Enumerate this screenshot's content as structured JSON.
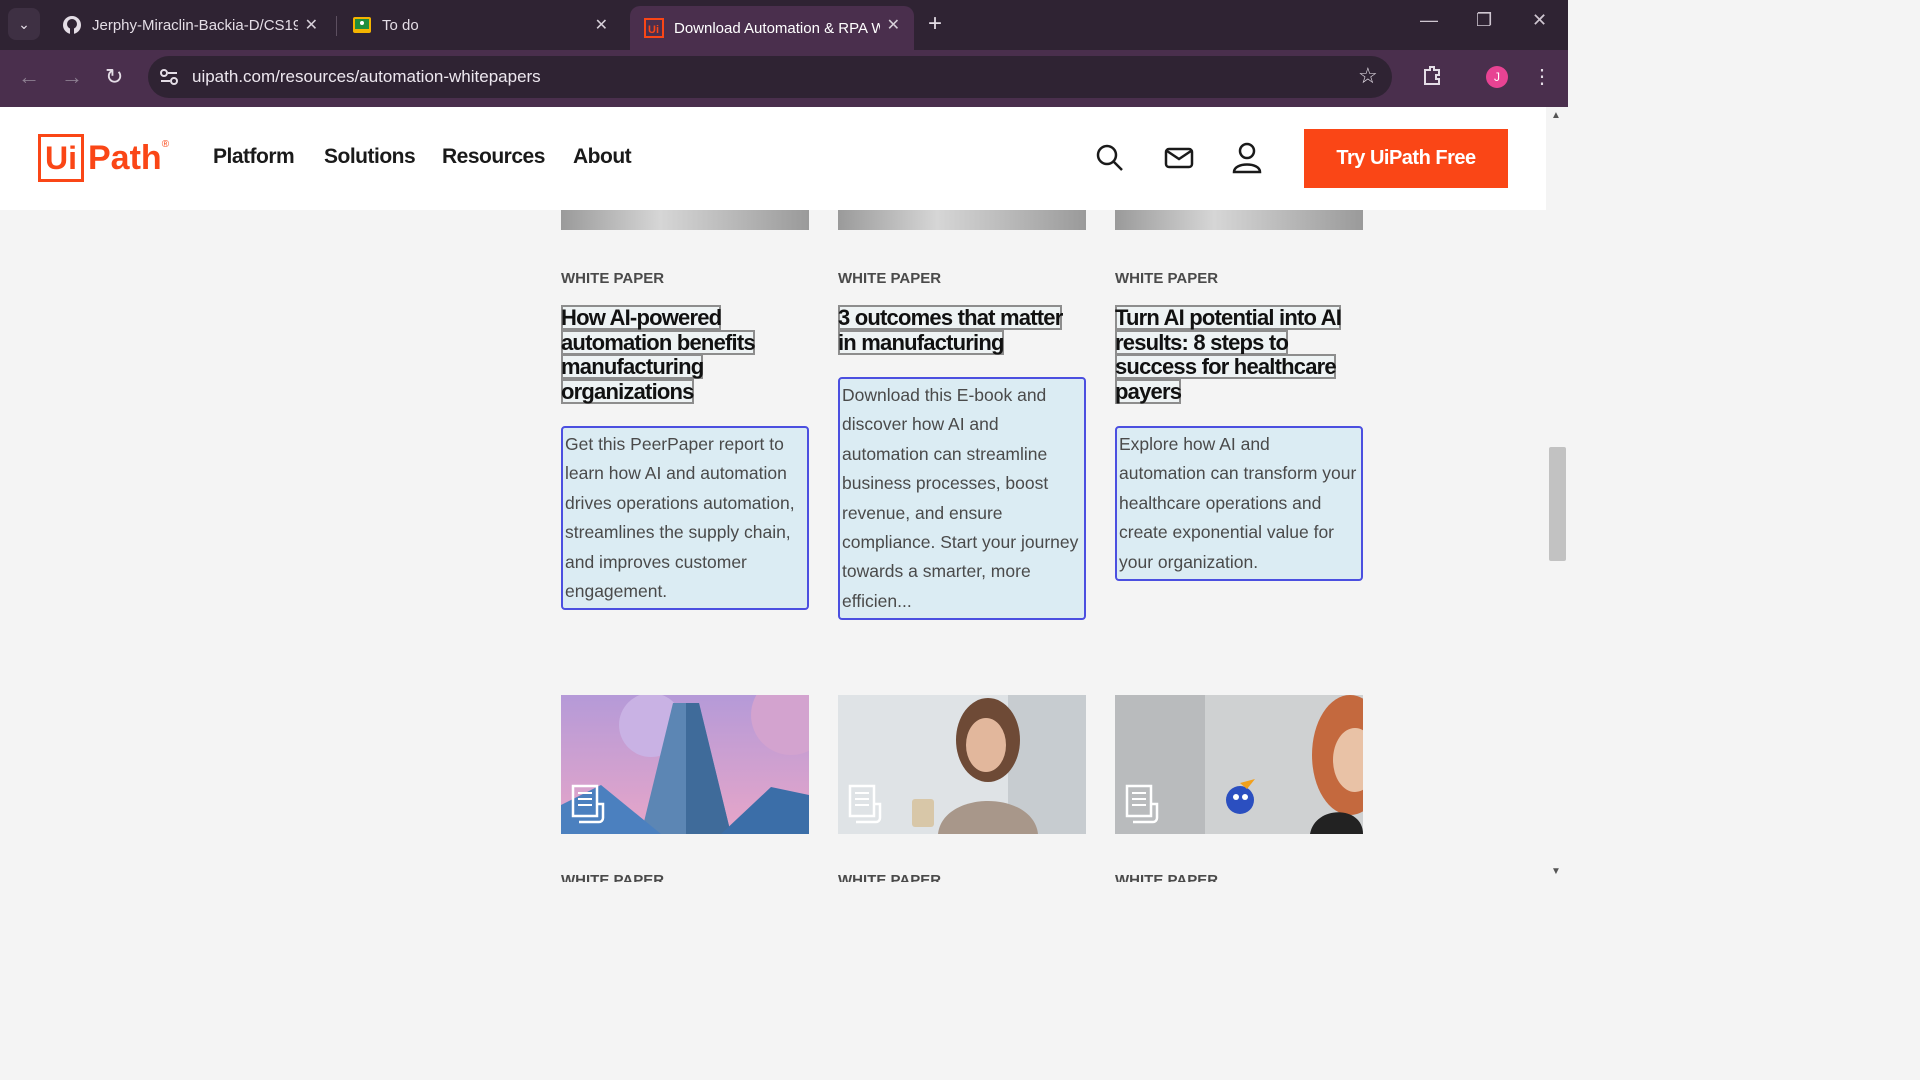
{
  "browser": {
    "tabs": [
      {
        "title": "Jerphy-Miraclin-Backia-D/CS19"
      },
      {
        "title": "To do"
      },
      {
        "title": "Download Automation & RPA W"
      }
    ],
    "url": "uipath.com/resources/automation-whitepapers",
    "profile_initial": "J"
  },
  "site": {
    "logo_boxed": "Ui",
    "logo_text": "Path",
    "logo_reg": "®",
    "nav": [
      "Platform",
      "Solutions",
      "Resources",
      "About"
    ],
    "cta": "Try UiPath Free",
    "accent": "#fa4616"
  },
  "cards_row1": [
    {
      "kicker": "WHITE PAPER",
      "title_lines": [
        "How AI-powered",
        "automation benefits",
        "manufacturing",
        "organizations"
      ],
      "desc": "Get this PeerPaper report to learn how AI and automation drives operations automation, streamlines the supply chain, and improves customer engagement."
    },
    {
      "kicker": "WHITE PAPER",
      "title_lines": [
        "3 outcomes that matter",
        "in manufacturing"
      ],
      "desc": "Download this E-book and discover how AI and automation can streamline business processes, boost revenue, and ensure compliance. Start your journey towards a smarter, more efficien..."
    },
    {
      "kicker": "WHITE PAPER",
      "title_lines": [
        "Turn AI potential into AI",
        "results: 8 steps to",
        "success for healthcare",
        "payers"
      ],
      "desc": "Explore how AI and automation can transform your healthcare operations and create exponential value for your organization."
    }
  ],
  "cards_row2": [
    {
      "kicker": "WHITE PAPER",
      "image": "skyscraper"
    },
    {
      "kicker": "WHITE PAPER",
      "image": "woman-with-phone"
    },
    {
      "kicker": "WHITE PAPER",
      "image": "smiling-woman-robot"
    }
  ]
}
